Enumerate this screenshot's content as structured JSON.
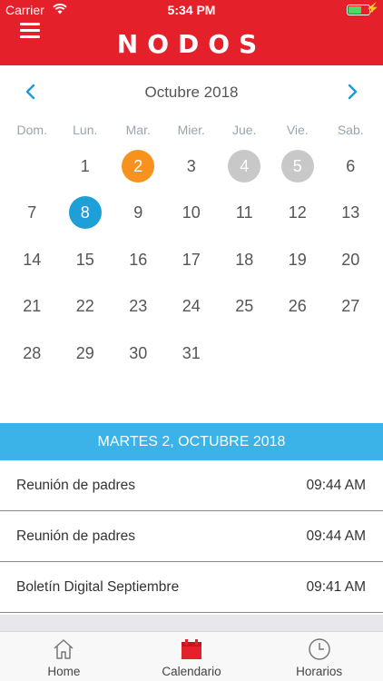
{
  "status_bar": {
    "carrier": "Carrier",
    "time": "5:34 PM",
    "bolt": "⚡"
  },
  "header": {
    "logo_text": "NODOS",
    "menu_icon": "hamburger-icon",
    "color": "#e4202a"
  },
  "calendar": {
    "month_label": "Octubre 2018",
    "prev_icon": "chevron-left-icon",
    "next_icon": "chevron-right-icon",
    "weekdays": [
      "Dom.",
      "Lun.",
      "Mar.",
      "Mier.",
      "Jue.",
      "Vie.",
      "Sab."
    ],
    "weeks": [
      [
        "",
        "1",
        "2",
        "3",
        "4",
        "5",
        "6"
      ],
      [
        "7",
        "8",
        "9",
        "10",
        "11",
        "12",
        "13"
      ],
      [
        "14",
        "15",
        "16",
        "17",
        "18",
        "19",
        "20"
      ],
      [
        "21",
        "22",
        "23",
        "24",
        "25",
        "26",
        "27"
      ],
      [
        "28",
        "29",
        "30",
        "31",
        "",
        "",
        ""
      ]
    ],
    "highlighted": {
      "selected": "2",
      "today": "8",
      "marked": [
        "4",
        "5"
      ]
    },
    "colors": {
      "selected": "#f7921e",
      "today": "#1e9fd8",
      "marked": "#c8c8c8",
      "accent": "#1a9ad6"
    }
  },
  "events": {
    "date_header": "MARTES 2, OCTUBRE 2018",
    "header_color": "#3bb3e8",
    "items": [
      {
        "title": "Reunión de padres",
        "time": "09:44 AM"
      },
      {
        "title": "Reunión de padres",
        "time": "09:44 AM"
      },
      {
        "title": "Boletín Digital Septiembre",
        "time": "09:41 AM"
      }
    ]
  },
  "tabbar": {
    "tabs": [
      {
        "label": "Home",
        "icon": "home-icon"
      },
      {
        "label": "Calendario",
        "icon": "calendar-icon",
        "active": true
      },
      {
        "label": "Horarios",
        "icon": "clock-icon"
      }
    ],
    "active_color": "#e4202a"
  }
}
